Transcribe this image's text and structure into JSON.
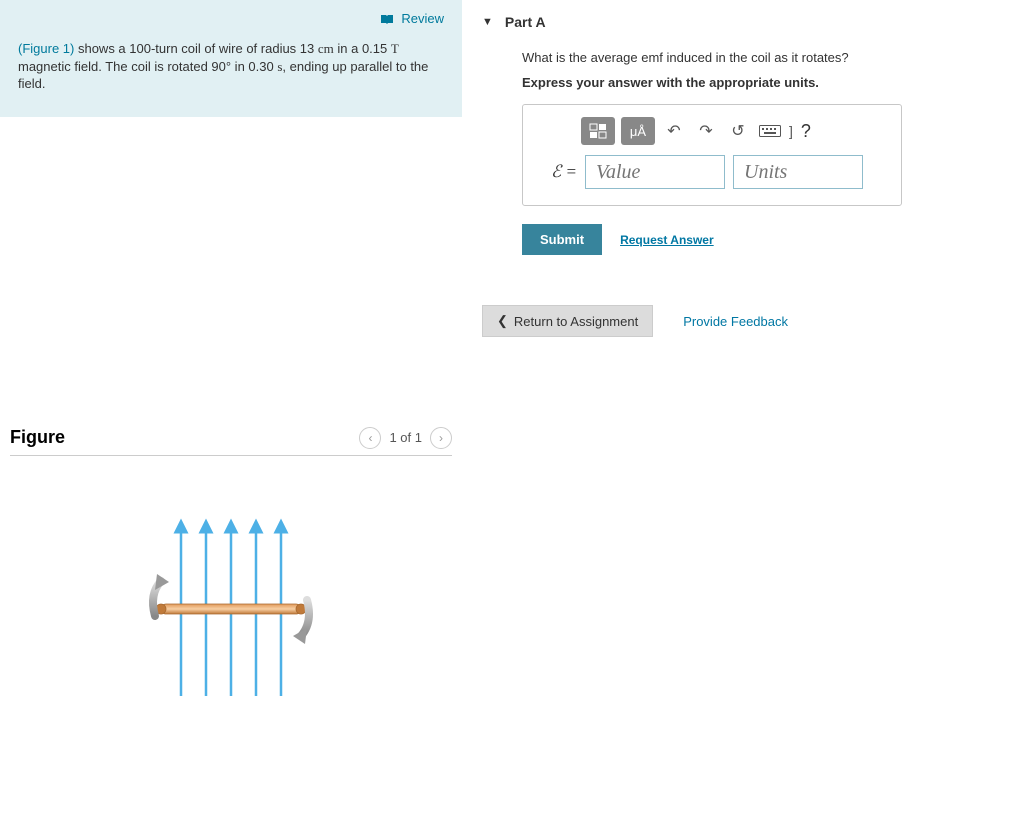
{
  "problem": {
    "review_label": "Review",
    "figure_ref": "(Figure 1)",
    "text_1": " shows a 100-turn coil of wire of radius 13 ",
    "unit_cm": "cm",
    "text_2": " in a 0.15 ",
    "unit_T": "T",
    "text_3": " magnetic field. The coil is rotated 90° in 0.30 ",
    "unit_s": "s",
    "text_4": ", ending up parallel to the field."
  },
  "figure": {
    "title": "Figure",
    "pager": "1 of 1"
  },
  "part": {
    "label": "Part A",
    "question": "What is the average emf induced in the coil as it rotates?",
    "instruction": "Express your answer with the appropriate units.",
    "toolbar": {
      "templates_label": "□",
      "units_label": "μÅ"
    },
    "eq_symbol": "ℰ =",
    "value_placeholder": "Value",
    "units_placeholder": "Units",
    "submit_label": "Submit",
    "request_label": "Request Answer"
  },
  "footer": {
    "return_label": "Return to Assignment",
    "feedback_label": "Provide Feedback"
  }
}
